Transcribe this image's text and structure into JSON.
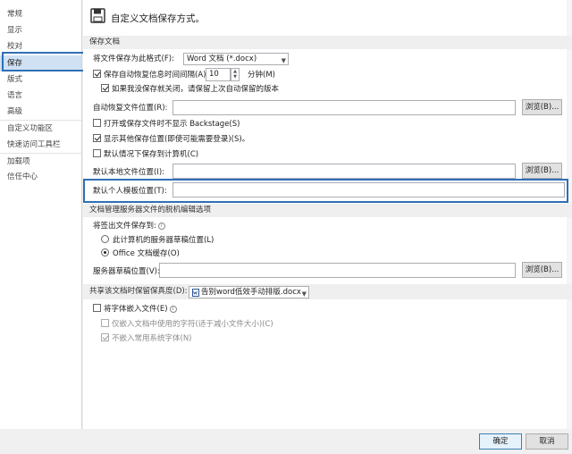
{
  "sidebar": {
    "items": [
      {
        "label": "常规"
      },
      {
        "label": "显示"
      },
      {
        "label": "校对"
      },
      {
        "label": "保存"
      },
      {
        "label": "版式"
      },
      {
        "label": "语言"
      },
      {
        "label": "高级"
      },
      {
        "label": "自定义功能区"
      },
      {
        "label": "快速访问工具栏"
      },
      {
        "label": "加载项"
      },
      {
        "label": "信任中心"
      }
    ]
  },
  "header": {
    "title": "自定义文档保存方式。",
    "icon": "floppy-disk-icon"
  },
  "save_docs": {
    "section_title": "保存文档",
    "format_label": "将文件保存为此格式(F):",
    "format_value": "Word 文档 (*.docx)",
    "autorecover_label": "保存自动恢复信息时间间隔(A)",
    "autorecover_checked": true,
    "autorecover_minutes": "10",
    "minutes_label": "分钟(M)",
    "keep_last_label": "如果我没保存就关闭，请保留上次自动保留的版本",
    "keep_last_checked": true,
    "autorecover_location_label": "自动恢复文件位置(R):",
    "browse_label": "浏览(B)...",
    "no_backstage_label": "打开或保存文件时不显示 Backstage(S)",
    "no_backstage_checked": false,
    "show_other_label": "显示其他保存位置(即使可能需要登录)(S)。",
    "show_other_checked": true,
    "default_computer_label": "默认情况下保存到计算机(C)",
    "default_computer_checked": false,
    "default_local_label": "默认本地文件位置(I):",
    "default_template_label": "默认个人模板位置(T):"
  },
  "offline": {
    "section_title": "文档管理服务器文件的脱机编辑选项",
    "checkout_label": "将签出文件保存到:",
    "radio_server": "此计算机的服务器草稿位置(L)",
    "radio_server_selected": false,
    "radio_office": "Office 文档缓存(O)",
    "radio_office_selected": true,
    "server_drafts_label": "服务器草稿位置(V):",
    "browse_label": "浏览(B)..."
  },
  "fidelity": {
    "section_label": "共享该文档时保留保真度(D):",
    "doc_value": "告别word低效手动排版.docx",
    "embed_fonts_label": "将字体嵌入文件(E)",
    "embed_fonts_checked": false,
    "only_used_label": "仅嵌入文档中使用的字符(适于减小文件大小)(C)",
    "only_used_checked": false,
    "no_common_label": "不嵌入常用系统字体(N)",
    "no_common_checked": true
  },
  "footer": {
    "ok_label": "确定",
    "cancel_label": "取消"
  }
}
